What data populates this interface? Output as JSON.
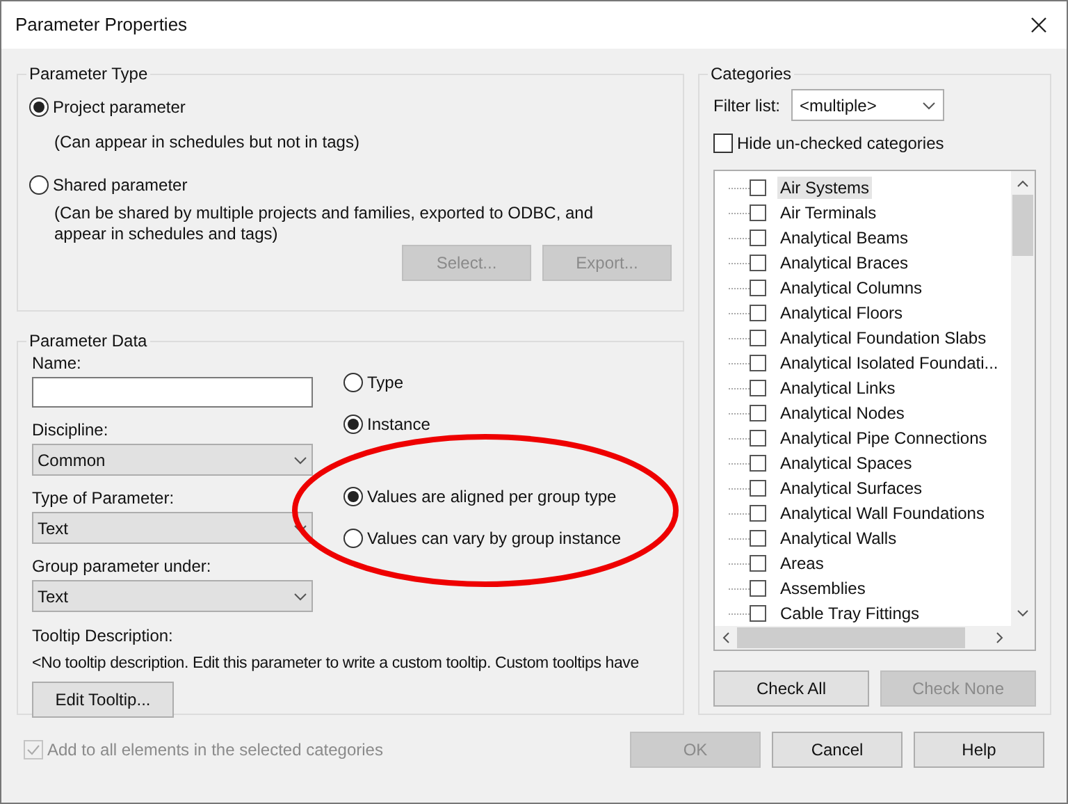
{
  "window": {
    "title": "Parameter Properties"
  },
  "parameter_type": {
    "title": "Parameter Type",
    "options": [
      {
        "label": "Project parameter",
        "selected": true,
        "description": "(Can appear in schedules but not in tags)"
      },
      {
        "label": "Shared parameter",
        "selected": false,
        "description": "(Can be shared by multiple projects and families, exported to ODBC, and appear in schedules and tags)"
      }
    ],
    "buttons": [
      {
        "label": "Select...",
        "disabled": true
      },
      {
        "label": "Export...",
        "disabled": true
      }
    ]
  },
  "parameter_data": {
    "title": "Parameter Data",
    "name": {
      "label": "Name:"
    },
    "discipline": {
      "label": "Discipline:",
      "value": "Common"
    },
    "type_of_parameter": {
      "label": "Type of Parameter:",
      "value": "Text"
    },
    "group_under": {
      "label": "Group parameter under:",
      "value": "Text"
    },
    "binding": [
      {
        "label": "Type",
        "selected": false
      },
      {
        "label": "Instance",
        "selected": true
      }
    ],
    "group_values": [
      {
        "label": "Values are aligned per group type",
        "selected": true
      },
      {
        "label": "Values can vary by group instance",
        "selected": false
      }
    ],
    "tooltip": {
      "label": "Tooltip Description:",
      "text": "<No tooltip description. Edit this parameter to write a custom tooltip. Custom tooltips have"
    },
    "edit_tooltip": {
      "label": "Edit Tooltip...",
      "disabled": false
    }
  },
  "categories": {
    "title": "Categories",
    "filter": {
      "label": "Filter list:",
      "value": "<multiple>"
    },
    "hide_unchecked": {
      "label": "Hide un-checked categories",
      "checked": false
    },
    "items": [
      {
        "label": "Air Systems",
        "checked": false,
        "selected": true
      },
      {
        "label": "Air Terminals",
        "checked": false,
        "selected": false
      },
      {
        "label": "Analytical Beams",
        "checked": false,
        "selected": false
      },
      {
        "label": "Analytical Braces",
        "checked": false,
        "selected": false
      },
      {
        "label": "Analytical Columns",
        "checked": false,
        "selected": false
      },
      {
        "label": "Analytical Floors",
        "checked": false,
        "selected": false
      },
      {
        "label": "Analytical Foundation Slabs",
        "checked": false,
        "selected": false
      },
      {
        "label": "Analytical Isolated Foundati...",
        "checked": false,
        "selected": false
      },
      {
        "label": "Analytical Links",
        "checked": false,
        "selected": false
      },
      {
        "label": "Analytical Nodes",
        "checked": false,
        "selected": false
      },
      {
        "label": "Analytical Pipe Connections",
        "checked": false,
        "selected": false
      },
      {
        "label": "Analytical Spaces",
        "checked": false,
        "selected": false
      },
      {
        "label": "Analytical Surfaces",
        "checked": false,
        "selected": false
      },
      {
        "label": "Analytical Wall Foundations",
        "checked": false,
        "selected": false
      },
      {
        "label": "Analytical Walls",
        "checked": false,
        "selected": false
      },
      {
        "label": "Areas",
        "checked": false,
        "selected": false
      },
      {
        "label": "Assemblies",
        "checked": false,
        "selected": false
      },
      {
        "label": "Cable Tray Fittings",
        "checked": false,
        "selected": false
      }
    ],
    "buttons": [
      {
        "label": "Check All",
        "disabled": false
      },
      {
        "label": "Check None",
        "disabled": true
      }
    ]
  },
  "add_to_all": {
    "label": "Add to all elements in the selected categories",
    "checked": true,
    "disabled": true
  },
  "footer_buttons": [
    {
      "label": "OK",
      "disabled": true
    },
    {
      "label": "Cancel",
      "disabled": false
    },
    {
      "label": "Help",
      "disabled": false
    }
  ]
}
